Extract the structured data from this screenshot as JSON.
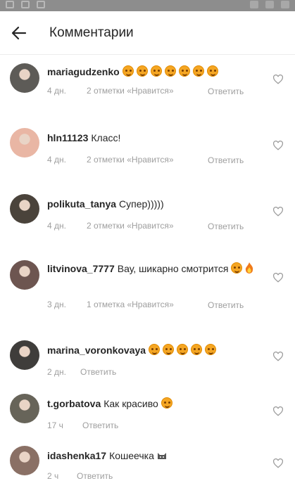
{
  "header": {
    "title": "Комментарии"
  },
  "comments": [
    {
      "username": "mariagudzenko",
      "text": "",
      "emoji": [
        "smile",
        "smile",
        "smile",
        "smile",
        "smile",
        "smile",
        "smile"
      ],
      "time": "4 дн.",
      "likes": "2 отметки «Нравится»",
      "reply": "Ответить",
      "avatar_color": "#5d5b57"
    },
    {
      "username": "hln11123",
      "text": "Класс!",
      "emoji": [],
      "time": "4 дн.",
      "likes": "2 отметки «Нравится»",
      "reply": "Ответить",
      "avatar_color": "#e9b6a4"
    },
    {
      "username": "polikuta_tanya",
      "text": "Супер)))))",
      "emoji": [],
      "time": "4 дн.",
      "likes": "2 отметки «Нравится»",
      "reply": "Ответить",
      "avatar_color": "#4a433b"
    },
    {
      "username": "litvinova_7777",
      "text": "Вау, шикарно смотрится",
      "emoji": [
        "smile",
        "fire"
      ],
      "time": "3 дн.",
      "likes": "1 отметка «Нравится»",
      "reply": "Ответить",
      "avatar_color": "#6d5550"
    },
    {
      "username": "marina_voronkovaya",
      "text": "",
      "emoji": [
        "smile",
        "smile",
        "smile",
        "smile",
        "smile"
      ],
      "time": "2 дн.",
      "likes": "",
      "reply": "Ответить",
      "avatar_color": "#3f3d3b"
    },
    {
      "username": "t.gorbatova",
      "text": "Как красиво",
      "emoji": [
        "smile"
      ],
      "time": "17 ч",
      "likes": "",
      "reply": "Ответить",
      "avatar_color": "#676459"
    },
    {
      "username": "idashenka17",
      "text": "Кошеечка",
      "emoji": [
        "cat"
      ],
      "time": "2 ч",
      "likes": "",
      "reply": "Ответить",
      "avatar_color": "#8a7065"
    }
  ]
}
